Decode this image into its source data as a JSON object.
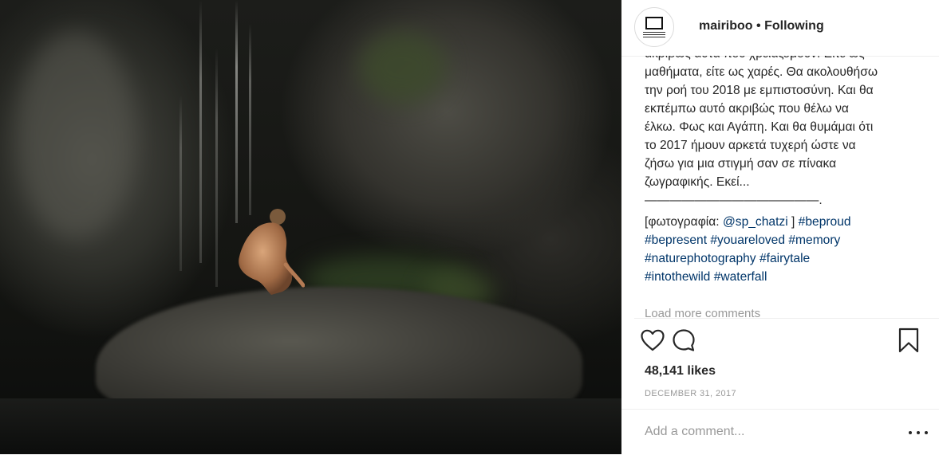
{
  "post": {
    "author": {
      "username": "mairiboo",
      "separator": "•",
      "follow_status": "Following",
      "avatar_icon": "brand-logo-icon"
    },
    "caption": {
      "lines": [
        "ακριβώς αυτά που χρειαζόμουν. Είτε ως",
        "μαθήματα, είτε ως χαρές. Θα ακολουθήσω",
        "την ροή του 2018 με εμπιστοσύνη. Και θα",
        "εκπέμπω αυτό ακριβώς που θέλω να",
        "έλκω. Φως και Αγάπη. Και θα θυμάμαι ότι",
        "το 2017 ήμουν αρκετά τυχερή ώστε να",
        "ζήσω για μια στιγμή σαν σε πίνακα",
        "ζωγραφικής. Εκεί..."
      ],
      "rule": "——————————————.",
      "credit_prefix": "[φωτογραφία: ",
      "credit_handle": "@sp_chatzi",
      "credit_suffix": " ] ",
      "hashtags": [
        "#beproud",
        "#bepresent",
        "#youareloved",
        "#memory",
        "#naturephotography",
        "#fairytale",
        "#intothewild",
        "#waterfall"
      ]
    },
    "load_more": "Load more comments",
    "actions": {
      "like_icon": "heart-icon",
      "comment_icon": "comment-bubble-icon",
      "save_icon": "bookmark-icon"
    },
    "likes": "48,141 likes",
    "date": "DECEMBER 31, 2017",
    "comment_placeholder": "Add a comment...",
    "more_icon": "more-options-icon"
  },
  "colors": {
    "link": "#003569",
    "text": "#262626",
    "muted": "#999999",
    "border": "#efefef"
  }
}
